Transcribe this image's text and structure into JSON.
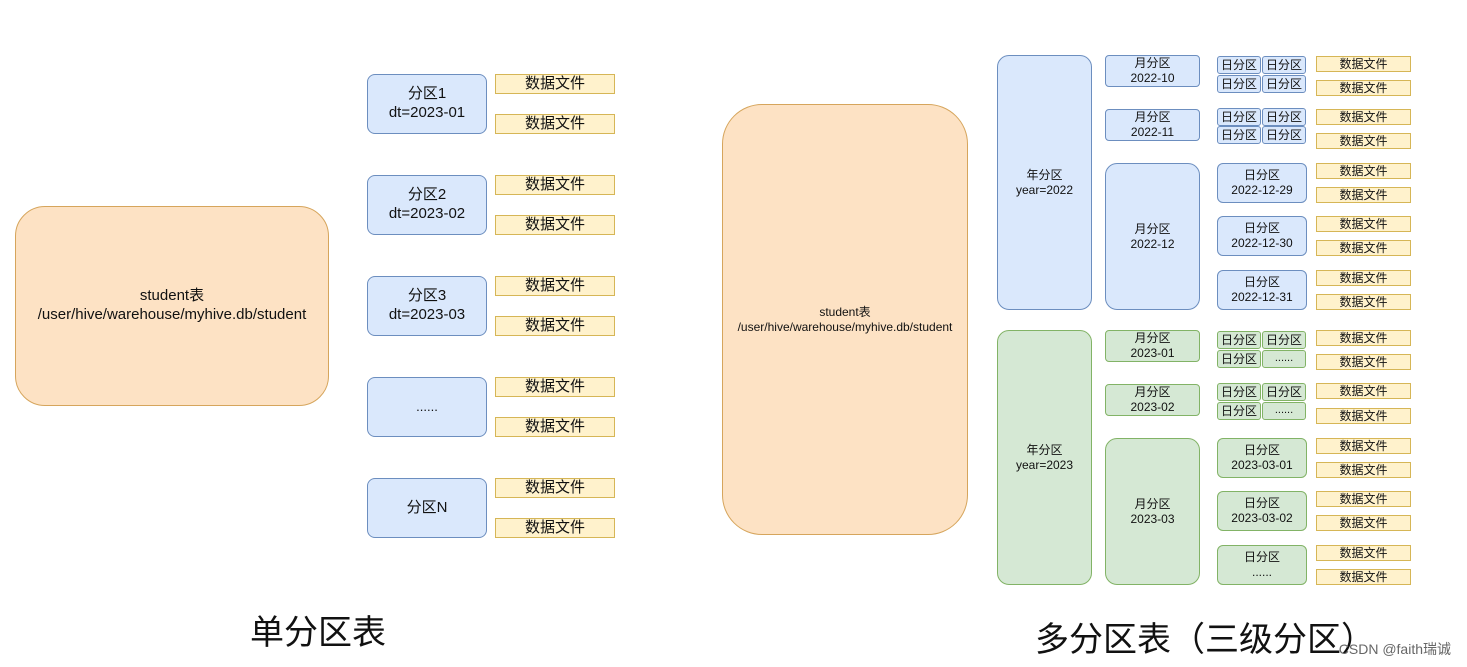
{
  "single": {
    "table_label": "student表",
    "table_path": "/user/hive/warehouse/myhive.db/student",
    "partitions": [
      {
        "line1": "分区1",
        "line2": "dt=2023-01"
      },
      {
        "line1": "分区2",
        "line2": "dt=2023-02"
      },
      {
        "line1": "分区3",
        "line2": "dt=2023-03"
      },
      {
        "line1": "......",
        "line2": ""
      },
      {
        "line1": "分区N",
        "line2": ""
      }
    ],
    "file_label": "数据文件",
    "caption": "单分区表"
  },
  "multi": {
    "table_label": "student表",
    "table_path": "/user/hive/warehouse/myhive.db/student",
    "years": [
      {
        "line1": "年分区",
        "line2": "year=2022"
      },
      {
        "line1": "年分区",
        "line2": "year=2023"
      }
    ],
    "months": [
      {
        "line1": "月分区",
        "line2": "2022-10"
      },
      {
        "line1": "月分区",
        "line2": "2022-11"
      },
      {
        "line1": "月分区",
        "line2": "2022-12"
      },
      {
        "line1": "月分区",
        "line2": "2023-01"
      },
      {
        "line1": "月分区",
        "line2": "2023-02"
      },
      {
        "line1": "月分区",
        "line2": "2023-03"
      }
    ],
    "day_small": "日分区",
    "day_more": "......",
    "days": [
      {
        "line1": "日分区",
        "line2": "2022-12-29"
      },
      {
        "line1": "日分区",
        "line2": "2022-12-30"
      },
      {
        "line1": "日分区",
        "line2": "2022-12-31"
      },
      {
        "line1": "日分区",
        "line2": "2023-03-01"
      },
      {
        "line1": "日分区",
        "line2": "2023-03-02"
      },
      {
        "line1": "日分区",
        "line2": "......"
      }
    ],
    "file_label": "数据文件",
    "caption": "多分区表（三级分区）"
  },
  "watermark": "CSDN @faith瑞诚"
}
